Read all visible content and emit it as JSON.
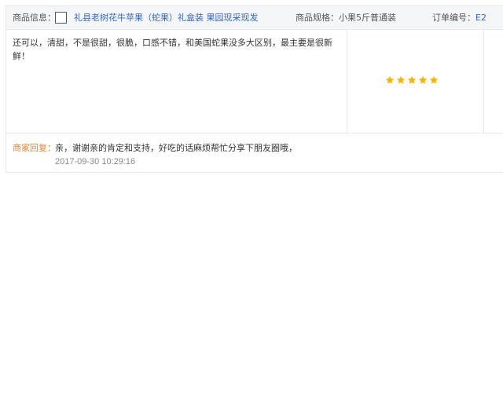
{
  "review": {
    "product_label": "商品信息：",
    "product_name": "礼县老树花牛苹果（蛇果）礼盒装 果园现采现发",
    "spec_label": "商品规格：",
    "spec_value": "小果5斤普通装",
    "order_label": "订单编号：",
    "order_value": "E2",
    "content": "还可以，清甜，不是很甜，很脆，口感不错，和美国蛇果没多大区别，最主要是很新鲜！",
    "rating": {
      "stars": 5,
      "max": 5,
      "color": "#f4b400"
    },
    "reply_label": "商家回复：",
    "reply_text": "亲，谢谢亲的肯定和支持，好吃的话麻烦帮忙分享下朋友圈哦，",
    "reply_time": "2017-09-30 10:29:16"
  },
  "colors": {
    "link": "#3366cc",
    "reply_label": "#e4842f",
    "info_bar_bg": "#f5f6f8"
  }
}
